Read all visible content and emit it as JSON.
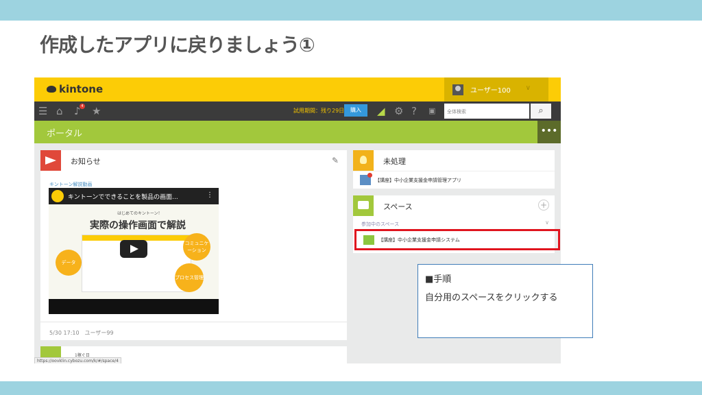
{
  "slide": {
    "title": "作成したアプリに戻りましょう①"
  },
  "kintone": {
    "logo": "kintone",
    "user": "ユーザー100",
    "nav": {
      "trial_text": "試用期間：残り29日",
      "buy_label": "購入",
      "notification_count": "4",
      "search_placeholder": "全体検索"
    },
    "portal": {
      "title": "ポータル"
    },
    "notice": {
      "title": "お知らせ",
      "video_link": "キントーン解説動画",
      "video_title": "キントーンでできることを製品の画面...",
      "video_sub": "はじめてのキントーン！",
      "video_headline": "実際の操作画面で解説",
      "bubble_data": "データ",
      "bubble_comm": "コミュニケーション",
      "bubble_process": "プロセス管理",
      "meta": "5/30 17:10　ユーザー99"
    },
    "next_card_label": "1稼ぐ日",
    "status_url": "https://oovklin.cybozu.com/k/#/space/4",
    "pending": {
      "title": "未処理",
      "item": "【講座】中小企業支援金申請管理アプリ"
    },
    "spaces": {
      "title": "スペース",
      "joined_label": "参加中のスペース",
      "item": "【講座】中小企業支援金申請システム"
    }
  },
  "instruction": {
    "heading": "■手順",
    "body": "自分用のスペースをクリックする"
  },
  "colors": {
    "band": "#9dd3e0",
    "kintone_yellow": "#fccc06",
    "portal_green": "#a2c83c",
    "highlight_red": "#e0141e"
  }
}
